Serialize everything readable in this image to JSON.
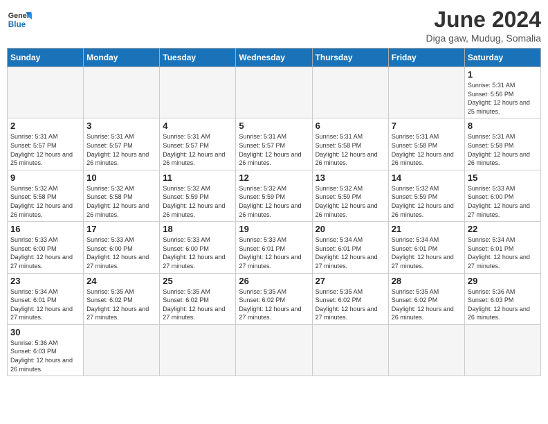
{
  "header": {
    "logo_general": "General",
    "logo_blue": "Blue",
    "title": "June 2024",
    "subtitle": "Diga gaw, Mudug, Somalia"
  },
  "days_of_week": [
    "Sunday",
    "Monday",
    "Tuesday",
    "Wednesday",
    "Thursday",
    "Friday",
    "Saturday"
  ],
  "weeks": [
    [
      {
        "day": "",
        "info": ""
      },
      {
        "day": "",
        "info": ""
      },
      {
        "day": "",
        "info": ""
      },
      {
        "day": "",
        "info": ""
      },
      {
        "day": "",
        "info": ""
      },
      {
        "day": "",
        "info": ""
      },
      {
        "day": "1",
        "info": "Sunrise: 5:31 AM\nSunset: 5:56 PM\nDaylight: 12 hours\nand 25 minutes."
      }
    ],
    [
      {
        "day": "2",
        "info": "Sunrise: 5:31 AM\nSunset: 5:57 PM\nDaylight: 12 hours\nand 25 minutes."
      },
      {
        "day": "3",
        "info": "Sunrise: 5:31 AM\nSunset: 5:57 PM\nDaylight: 12 hours\nand 26 minutes."
      },
      {
        "day": "4",
        "info": "Sunrise: 5:31 AM\nSunset: 5:57 PM\nDaylight: 12 hours\nand 26 minutes."
      },
      {
        "day": "5",
        "info": "Sunrise: 5:31 AM\nSunset: 5:57 PM\nDaylight: 12 hours\nand 26 minutes."
      },
      {
        "day": "6",
        "info": "Sunrise: 5:31 AM\nSunset: 5:58 PM\nDaylight: 12 hours\nand 26 minutes."
      },
      {
        "day": "7",
        "info": "Sunrise: 5:31 AM\nSunset: 5:58 PM\nDaylight: 12 hours\nand 26 minutes."
      },
      {
        "day": "8",
        "info": "Sunrise: 5:31 AM\nSunset: 5:58 PM\nDaylight: 12 hours\nand 26 minutes."
      }
    ],
    [
      {
        "day": "9",
        "info": "Sunrise: 5:32 AM\nSunset: 5:58 PM\nDaylight: 12 hours\nand 26 minutes."
      },
      {
        "day": "10",
        "info": "Sunrise: 5:32 AM\nSunset: 5:58 PM\nDaylight: 12 hours\nand 26 minutes."
      },
      {
        "day": "11",
        "info": "Sunrise: 5:32 AM\nSunset: 5:59 PM\nDaylight: 12 hours\nand 26 minutes."
      },
      {
        "day": "12",
        "info": "Sunrise: 5:32 AM\nSunset: 5:59 PM\nDaylight: 12 hours\nand 26 minutes."
      },
      {
        "day": "13",
        "info": "Sunrise: 5:32 AM\nSunset: 5:59 PM\nDaylight: 12 hours\nand 26 minutes."
      },
      {
        "day": "14",
        "info": "Sunrise: 5:32 AM\nSunset: 5:59 PM\nDaylight: 12 hours\nand 26 minutes."
      },
      {
        "day": "15",
        "info": "Sunrise: 5:33 AM\nSunset: 6:00 PM\nDaylight: 12 hours\nand 27 minutes."
      }
    ],
    [
      {
        "day": "16",
        "info": "Sunrise: 5:33 AM\nSunset: 6:00 PM\nDaylight: 12 hours\nand 27 minutes."
      },
      {
        "day": "17",
        "info": "Sunrise: 5:33 AM\nSunset: 6:00 PM\nDaylight: 12 hours\nand 27 minutes."
      },
      {
        "day": "18",
        "info": "Sunrise: 5:33 AM\nSunset: 6:00 PM\nDaylight: 12 hours\nand 27 minutes."
      },
      {
        "day": "19",
        "info": "Sunrise: 5:33 AM\nSunset: 6:01 PM\nDaylight: 12 hours\nand 27 minutes."
      },
      {
        "day": "20",
        "info": "Sunrise: 5:34 AM\nSunset: 6:01 PM\nDaylight: 12 hours\nand 27 minutes."
      },
      {
        "day": "21",
        "info": "Sunrise: 5:34 AM\nSunset: 6:01 PM\nDaylight: 12 hours\nand 27 minutes."
      },
      {
        "day": "22",
        "info": "Sunrise: 5:34 AM\nSunset: 6:01 PM\nDaylight: 12 hours\nand 27 minutes."
      }
    ],
    [
      {
        "day": "23",
        "info": "Sunrise: 5:34 AM\nSunset: 6:01 PM\nDaylight: 12 hours\nand 27 minutes."
      },
      {
        "day": "24",
        "info": "Sunrise: 5:35 AM\nSunset: 6:02 PM\nDaylight: 12 hours\nand 27 minutes."
      },
      {
        "day": "25",
        "info": "Sunrise: 5:35 AM\nSunset: 6:02 PM\nDaylight: 12 hours\nand 27 minutes."
      },
      {
        "day": "26",
        "info": "Sunrise: 5:35 AM\nSunset: 6:02 PM\nDaylight: 12 hours\nand 27 minutes."
      },
      {
        "day": "27",
        "info": "Sunrise: 5:35 AM\nSunset: 6:02 PM\nDaylight: 12 hours\nand 27 minutes."
      },
      {
        "day": "28",
        "info": "Sunrise: 5:35 AM\nSunset: 6:02 PM\nDaylight: 12 hours\nand 26 minutes."
      },
      {
        "day": "29",
        "info": "Sunrise: 5:36 AM\nSunset: 6:03 PM\nDaylight: 12 hours\nand 26 minutes."
      }
    ],
    [
      {
        "day": "30",
        "info": "Sunrise: 5:36 AM\nSunset: 6:03 PM\nDaylight: 12 hours\nand 26 minutes."
      },
      {
        "day": "",
        "info": ""
      },
      {
        "day": "",
        "info": ""
      },
      {
        "day": "",
        "info": ""
      },
      {
        "day": "",
        "info": ""
      },
      {
        "day": "",
        "info": ""
      },
      {
        "day": "",
        "info": ""
      }
    ]
  ]
}
